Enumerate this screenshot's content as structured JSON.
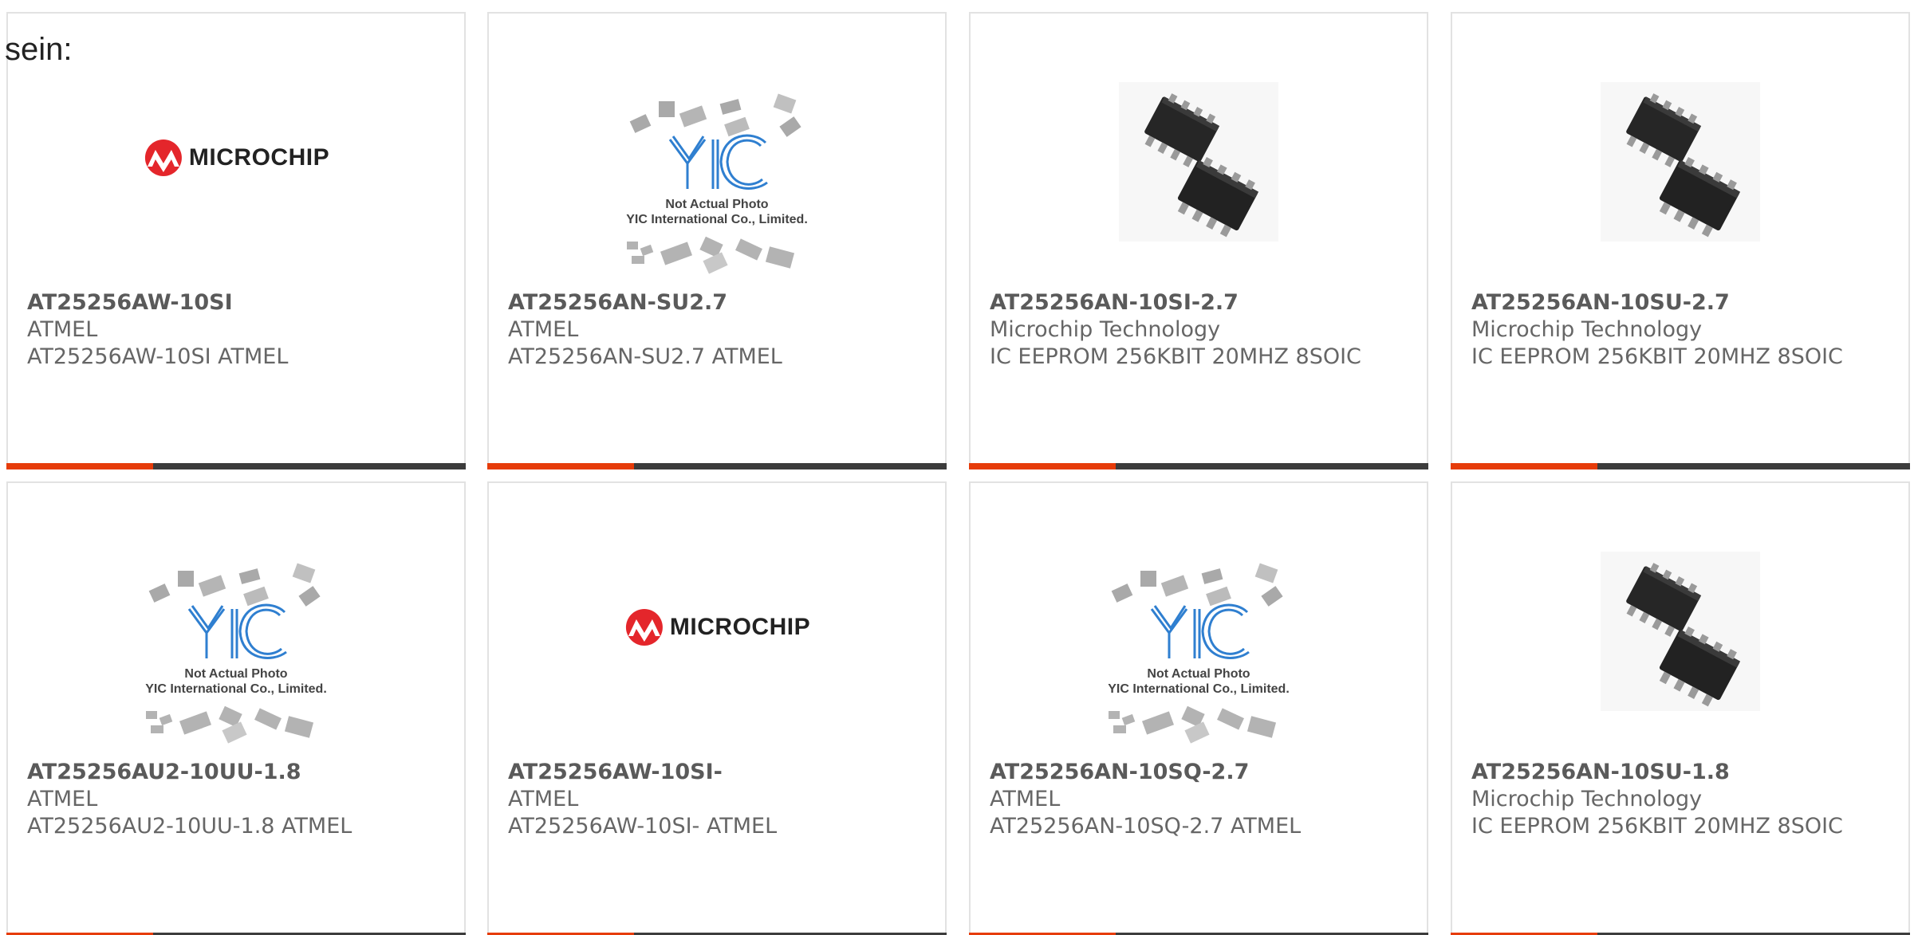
{
  "intro_text": "sein:",
  "logo": {
    "microchip_text": "MICROCHIP",
    "yic_note_line1": "Not Actual Photo",
    "yic_note_line2": "YIC International Co., Limited."
  },
  "colors": {
    "accent": "#e63c0a",
    "bar": "#3c3c3c",
    "text": "#666666",
    "border": "#e2e2e2"
  },
  "products": [
    {
      "part": "AT25256AW-10SI",
      "manufacturer": "ATMEL",
      "description": "AT25256AW-10SI ATMEL",
      "image": "microchip-logo"
    },
    {
      "part": "AT25256AN-SU2.7",
      "manufacturer": "ATMEL",
      "description": "AT25256AN-SU2.7 ATMEL",
      "image": "yic-placeholder"
    },
    {
      "part": "AT25256AN-10SI-2.7",
      "manufacturer": "Microchip Technology",
      "description": "IC EEPROM 256KBIT 20MHZ 8SOIC",
      "image": "soic-chip-photo"
    },
    {
      "part": "AT25256AN-10SU-2.7",
      "manufacturer": "Microchip Technology",
      "description": "IC EEPROM 256KBIT 20MHZ 8SOIC",
      "image": "soic-chip-photo"
    },
    {
      "part": "AT25256AU2-10UU-1.8",
      "manufacturer": "ATMEL",
      "description": "AT25256AU2-10UU-1.8 ATMEL",
      "image": "yic-placeholder"
    },
    {
      "part": "AT25256AW-10SI-",
      "manufacturer": "ATMEL",
      "description": "AT25256AW-10SI- ATMEL",
      "image": "microchip-logo"
    },
    {
      "part": "AT25256AN-10SQ-2.7",
      "manufacturer": "ATMEL",
      "description": "AT25256AN-10SQ-2.7 ATMEL",
      "image": "yic-placeholder"
    },
    {
      "part": "AT25256AN-10SU-1.8",
      "manufacturer": "Microchip Technology",
      "description": "IC EEPROM 256KBIT 20MHZ 8SOIC",
      "image": "soic-chip-photo"
    }
  ]
}
